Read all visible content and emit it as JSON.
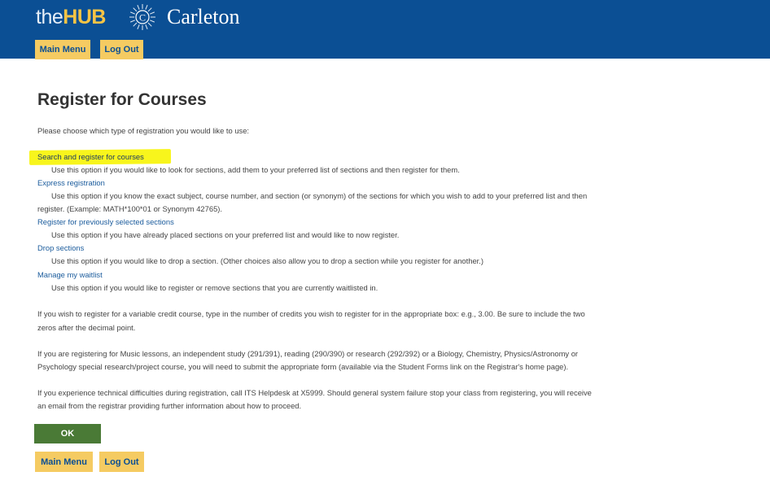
{
  "header": {
    "logo_the": "the",
    "logo_hub": "HUB",
    "seal_letter": "C",
    "institution": "Carleton",
    "nav": {
      "main_menu": "Main Menu",
      "log_out": "Log Out"
    }
  },
  "page": {
    "title": "Register for Courses",
    "intro": "Please choose which type of registration you would like to use:",
    "options": [
      {
        "label": "Search and register for courses",
        "highlighted": true,
        "description": [
          "Use this option if you would like to look for sections, add them to your preferred list of sections and then register for them."
        ]
      },
      {
        "label": "Express registration",
        "highlighted": false,
        "description": [
          "Use this option if you know the exact subject, course number, and section (or synonym) of the sections for which you wish to add to your preferred list and then",
          "register. (Example: MATH*100*01 or Synonym 42765)."
        ]
      },
      {
        "label": "Register for previously selected sections",
        "highlighted": false,
        "description": [
          "Use this option if you have already placed sections on your preferred list and would like to now register."
        ]
      },
      {
        "label": "Drop sections",
        "highlighted": false,
        "description": [
          "Use this option if you would like to drop a section. (Other choices also allow you to drop a section while you register for another.)"
        ]
      },
      {
        "label": "Manage my waitlist",
        "highlighted": false,
        "description": [
          "Use this option if you would like to register or remove sections that you are currently waitlisted in."
        ]
      }
    ],
    "notes": [
      [
        "If you wish to register for a variable credit course, type in the number of credits you wish to register for in the appropriate box: e.g., 3.00. Be sure to include the two",
        "zeros after the decimal point."
      ],
      [
        "If you are registering for Music lessons, an independent study (291/391), reading (290/390) or research (292/392) or a Biology, Chemistry, Physics/Astronomy or",
        "Psychology special research/project course, you will need to submit the appropriate form (available via the Student Forms link on the Registrar's home page)."
      ],
      [
        "If you experience technical difficulties during registration, call ITS Helpdesk at X5999. Should general system failure stop your class from registering, you will receive",
        "an email from the registrar providing further information about how to proceed."
      ]
    ],
    "ok_label": "OK"
  },
  "footer_nav": {
    "main_menu": "Main Menu",
    "log_out": "Log Out"
  },
  "colors": {
    "header_bg": "#0b4f94",
    "hub_accent": "#f6c445",
    "nav_button_bg": "#f5cb62",
    "nav_button_text": "#0b4f94",
    "link": "#1a5b9c",
    "ok_button_bg": "#4a7a36",
    "highlight": "#f8f51c"
  }
}
